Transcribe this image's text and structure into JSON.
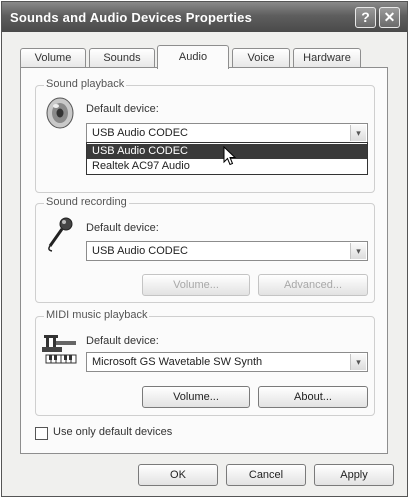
{
  "window": {
    "title": "Sounds and Audio Devices Properties"
  },
  "titlebar": {
    "help_label": "?",
    "close_label": "✕"
  },
  "tabs": [
    {
      "label": "Volume"
    },
    {
      "label": "Sounds"
    },
    {
      "label": "Audio",
      "active": true
    },
    {
      "label": "Voice"
    },
    {
      "label": "Hardware"
    }
  ],
  "playback": {
    "group_label": "Sound playback",
    "device_label": "Default device:",
    "selected": "USB Audio CODEC",
    "options": [
      "USB Audio CODEC",
      "Realtek AC97 Audio"
    ]
  },
  "recording": {
    "group_label": "Sound recording",
    "device_label": "Default device:",
    "selected": "USB Audio CODEC",
    "volume_label": "Volume...",
    "advanced_label": "Advanced..."
  },
  "midi": {
    "group_label": "MIDI music playback",
    "device_label": "Default device:",
    "selected": "Microsoft GS Wavetable SW Synth",
    "volume_label": "Volume...",
    "about_label": "About..."
  },
  "default_only": {
    "label": "Use only default devices",
    "checked": false
  },
  "footer": {
    "ok_label": "OK",
    "cancel_label": "Cancel",
    "apply_label": "Apply"
  },
  "icons": {
    "speaker": "speaker-icon",
    "microphone": "microphone-icon",
    "midi": "midi-keyboard-icon",
    "arrow": "▾",
    "cursor": "mouse-pointer-icon"
  }
}
